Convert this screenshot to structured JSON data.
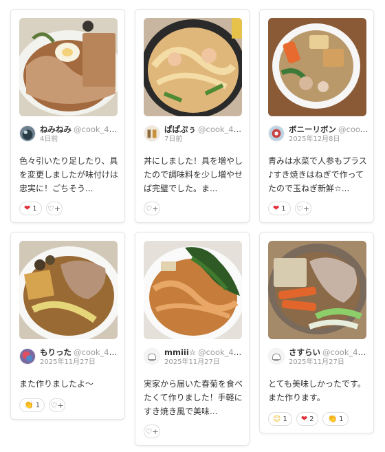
{
  "cards": [
    {
      "name": "ねみねみ",
      "id": "@cook_40...",
      "date": "4日前",
      "comment": "色々引いたり足したり、具を変更しましたが味付けは忠実に！ごちそう...",
      "reactions": [
        {
          "icon": "heart-icon",
          "glyph": "❤",
          "count": "1"
        }
      ]
    },
    {
      "name": "ぱぱぷぅ",
      "id": "@cook_40...",
      "date": "7日前",
      "comment": "丼にしました！具を増やしたので調味料を少し増やせば完璧でした。ま...",
      "reactions": []
    },
    {
      "name": "ボニーリボン",
      "id": "@cook...",
      "date": "2025年12月8日",
      "comment": "青みは水菜で人参もプラス♪すき焼きはねぎで作ってたので玉ねぎ新鮮☆...",
      "reactions": [
        {
          "icon": "heart-icon",
          "glyph": "❤",
          "count": "1"
        }
      ]
    },
    {
      "name": "もりった",
      "id": "@cook_40...",
      "date": "2025年11月27日",
      "comment": "また作りましたよ〜",
      "reactions": [
        {
          "icon": "clap-icon",
          "glyph": "👏",
          "count": "1"
        }
      ]
    },
    {
      "name": "mmiii☆",
      "id": "@cook_406...",
      "date": "2025年11月27日",
      "comment": "実家から届いた春菊を食べたくて作りました！手軽にすき焼き風で美味...",
      "reactions": []
    },
    {
      "name": "さすらい",
      "id": "@cook_40...",
      "date": "2025年11月27日",
      "comment": "とても美味しかったです。また作ります。",
      "reactions": [
        {
          "icon": "smile-icon",
          "glyph": "😊",
          "count": "1"
        },
        {
          "icon": "heart-icon",
          "glyph": "❤",
          "count": "2"
        },
        {
          "icon": "clap-icon",
          "glyph": "👏",
          "count": "1"
        }
      ]
    }
  ],
  "add_reaction_icon": "add-reaction-icon",
  "add_reaction_glyph": "♡+",
  "colors": {
    "heart": "#e0303a",
    "border": "#e6e6e6",
    "muted": "#999999"
  }
}
